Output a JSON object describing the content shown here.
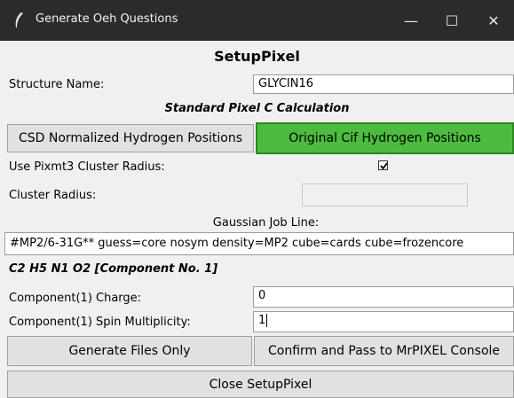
{
  "window": {
    "title": "Generate Oeh Questions",
    "controls": {
      "minimize": "—",
      "maximize": "☐",
      "close": "✕"
    }
  },
  "heading": "SetupPixel",
  "structure": {
    "label": "Structure Name:",
    "value": "GLYCIN16"
  },
  "calc_title": "Standard Pixel C Calculation",
  "hydrogen_buttons": {
    "csd": "CSD Normalized Hydrogen Positions",
    "cif": "Original Cif Hydrogen Positions"
  },
  "cluster": {
    "use_label": "Use Pixmt3 Cluster Radius:",
    "use_checked": true,
    "radius_label": "Cluster Radius:",
    "radius_value": ""
  },
  "gaussian": {
    "label": "Gaussian Job Line:",
    "value": "#MP2/6-31G** guess=core nosym density=MP2 cube=cards cube=frozencore"
  },
  "component": {
    "title": "C2 H5 N1 O2 [Component No. 1]",
    "charge_label": "Component(1) Charge:",
    "charge_value": "0",
    "spin_label": "Component(1) Spin Multiplicity:",
    "spin_value": "1"
  },
  "actions": {
    "generate": "Generate Files Only",
    "confirm": "Confirm and Pass to MrPIXEL Console",
    "close": "Close SetupPixel"
  },
  "colors": {
    "titlebar": "#2b2b2b",
    "accent_green": "#4cbb3f",
    "background": "#f0f0f0"
  }
}
